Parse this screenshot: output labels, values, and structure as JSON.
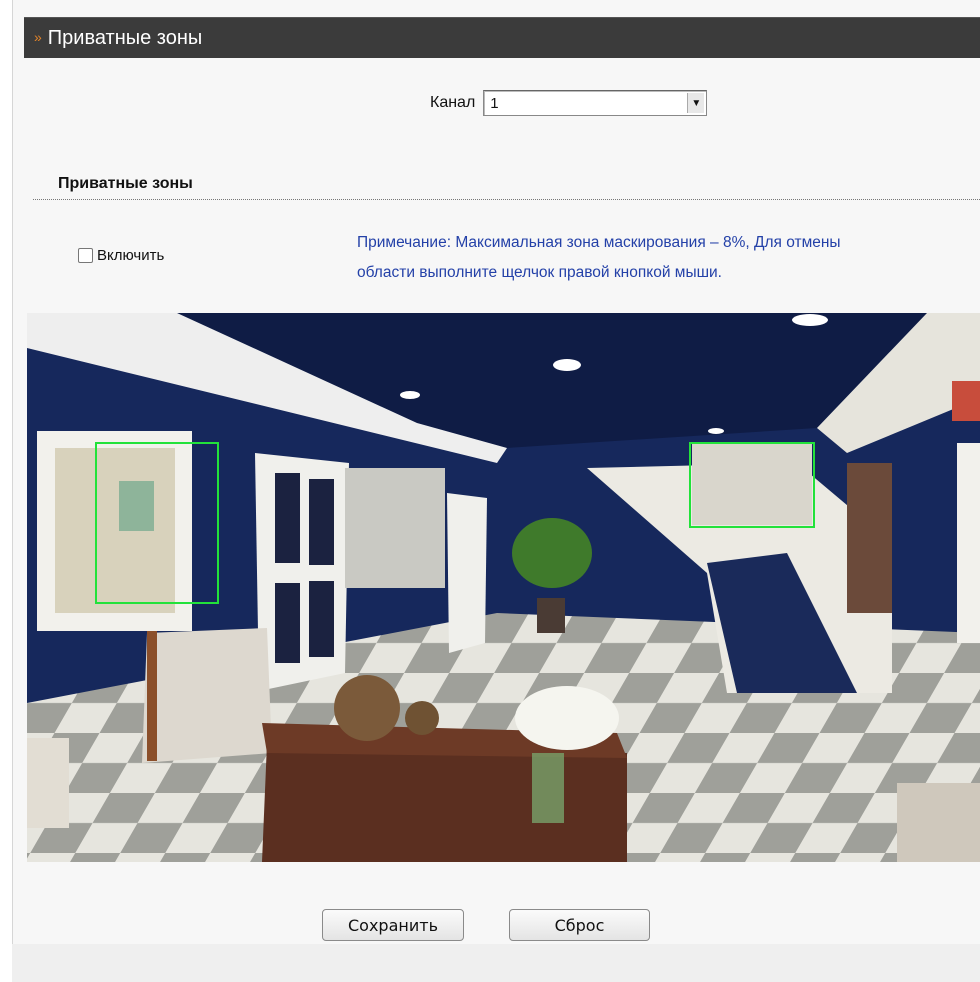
{
  "header": {
    "title": "Приватные зоны"
  },
  "channel": {
    "label": "Канал",
    "selected": "1"
  },
  "section": {
    "title": "Приватные зоны"
  },
  "enable": {
    "label": "Включить",
    "checked": false
  },
  "note": {
    "line1": "Примечание: Максимальная зона маскирования – 8%, Для отмены",
    "line2": "области выполните щелчок правой кнопкой мыши."
  },
  "buttons": {
    "save": "Сохранить",
    "reset": "Сброс"
  },
  "colors": {
    "header_bg": "#3b3b3b",
    "accent": "#e0832a",
    "note_text": "#2441a8",
    "zone_border": "#22e23a"
  },
  "icons": {
    "header_chevron": "chevron-double-down-icon",
    "select_arrow": "triangle-down-icon"
  }
}
